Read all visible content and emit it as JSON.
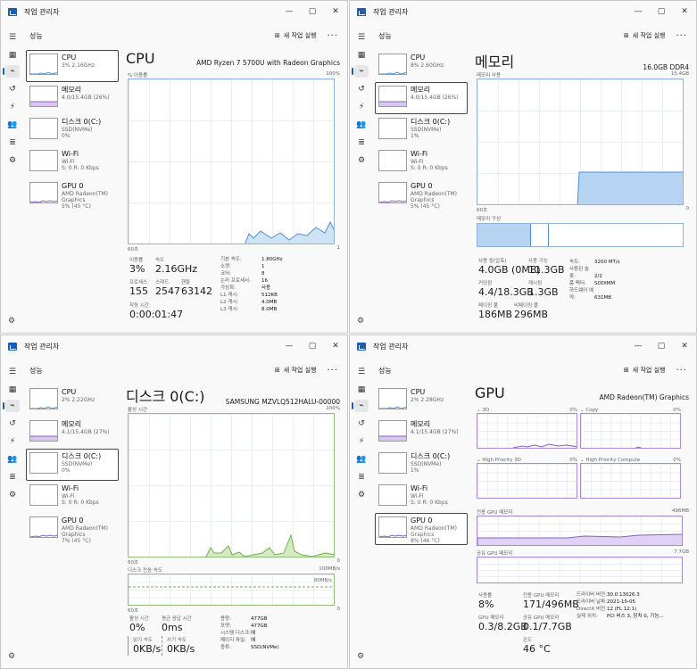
{
  "app_title": "작업 관리자",
  "page_title": "성능",
  "run_task": "새 작업 실행",
  "sidebar": [
    {
      "name": "CPU",
      "sub1": "3% 2.16GHz",
      "sub2": ""
    },
    {
      "name": "메모리",
      "sub1": "4.0/15.4GB (26%)",
      "sub2": ""
    },
    {
      "name": "디스크 0(C:)",
      "sub1": "SSD(NVMe)",
      "sub2": "0%"
    },
    {
      "name": "Wi-Fi",
      "sub1": "Wi-Fi",
      "sub2": "S: 0 R: 0 Kbps"
    },
    {
      "name": "GPU 0",
      "sub1": "AMD Radeon(TM) Graphics",
      "sub2": "5% (45 °C)"
    }
  ],
  "cpu": {
    "title": "CPU",
    "model": "AMD Ryzen 7 5700U with Radeon Graphics",
    "graph_label": "% 이용률",
    "graph_max": "100%",
    "graph_left": "60초",
    "graph_right": "1",
    "util_label": "이용률",
    "util": "3%",
    "speed_label": "속도",
    "speed": "2.16GHz",
    "proc_label": "프로세스",
    "proc": "155",
    "thread_label": "스레드",
    "thread": "2547",
    "handle_label": "핸들",
    "handle": "63142",
    "uptime_label": "작동 시간",
    "uptime": "0:00:01:47",
    "details": [
      [
        "기본 속도:",
        "1.80GHz"
      ],
      [
        "소켓:",
        "1"
      ],
      [
        "코어:",
        "8"
      ],
      [
        "논리 프로세서:",
        "16"
      ],
      [
        "가상화:",
        "사용"
      ],
      [
        "L1 캐시:",
        "512KB"
      ],
      [
        "L2 캐시:",
        "4.0MB"
      ],
      [
        "L3 캐시:",
        "8.0MB"
      ]
    ]
  },
  "mem_sidebar": [
    {
      "name": "CPU",
      "sub1": "8% 2.60GHz",
      "sub2": ""
    },
    {
      "name": "메모리",
      "sub1": "4.0/15.4GB (26%)",
      "sub2": ""
    },
    {
      "name": "디스크 0(C:)",
      "sub1": "SSD(NVMe)",
      "sub2": "1%"
    },
    {
      "name": "Wi-Fi",
      "sub1": "Wi-Fi",
      "sub2": "S: 0 R: 0 Kbps"
    },
    {
      "name": "GPU 0",
      "sub1": "AMD Radeon(TM) Graphics",
      "sub2": "5% (45 °C)"
    }
  ],
  "memory": {
    "title": "메모리",
    "size": "16.0GB DDR4",
    "graph_label": "메모리 사용",
    "graph_max": "15.4GB",
    "graph_left": "60초",
    "graph_right": "0",
    "comp_label": "메모리 구성",
    "used_label": "사용 중(압축)",
    "used": "4.0GB (0MB)",
    "avail_label": "사용 가능",
    "avail": "11.3GB",
    "commit_label": "커밋됨",
    "commit": "4.4/18.3GB",
    "cache_label": "캐시됨",
    "cache": "1.3GB",
    "paged_label": "페이징 풀",
    "paged": "186MB",
    "nonpaged_label": "비페이징 풀",
    "nonpaged": "296MB",
    "details": [
      [
        "속도:",
        "3200 MT/s"
      ],
      [
        "사용된 슬롯:",
        "2/2"
      ],
      [
        "폼 팩터:",
        "SODIMM"
      ],
      [
        "하드웨어 예약:",
        "631MB"
      ]
    ]
  },
  "disk_sidebar": [
    {
      "name": "CPU",
      "sub1": "2% 2.22GHz",
      "sub2": ""
    },
    {
      "name": "메모리",
      "sub1": "4.1/15.4GB (27%)",
      "sub2": ""
    },
    {
      "name": "디스크 0(C:)",
      "sub1": "SSD(NVMe)",
      "sub2": "0%"
    },
    {
      "name": "Wi-Fi",
      "sub1": "Wi-Fi",
      "sub2": "S: 0 R: 0 Kbps"
    },
    {
      "name": "GPU 0",
      "sub1": "AMD Radeon(TM) Graphics",
      "sub2": "7% (45 °C)"
    }
  ],
  "disk": {
    "title": "디스크 0(C:)",
    "model": "SAMSUNG MZVLQ512HALU-00000",
    "graph_label": "활성 시간",
    "graph_max": "100%",
    "graph_left": "60초",
    "graph_right": "0",
    "speed_label": "디스크 전송 속도",
    "speed_max": "100MB/s",
    "speed_mid": "80MB/s",
    "speed_left": "60초",
    "speed_right": "0",
    "active_label": "활성 시간",
    "active": "0%",
    "resp_label": "평균 응답 시간",
    "resp": "0ms",
    "read_label": "읽기 속도",
    "read": "0KB/s",
    "write_label": "쓰기 속도",
    "write": "0KB/s",
    "details": [
      [
        "용량:",
        "477GB"
      ],
      [
        "포맷:",
        "477GB"
      ],
      [
        "시스템 디스크:",
        "예"
      ],
      [
        "페이지 파일:",
        "예"
      ],
      [
        "종류:",
        "SSD(NVMe)"
      ]
    ]
  },
  "gpu_sidebar": [
    {
      "name": "CPU",
      "sub1": "2% 2.28GHz",
      "sub2": ""
    },
    {
      "name": "메모리",
      "sub1": "4.1/15.4GB (27%)",
      "sub2": ""
    },
    {
      "name": "디스크 0(C:)",
      "sub1": "SSD(NVMe)",
      "sub2": "1%"
    },
    {
      "name": "Wi-Fi",
      "sub1": "Wi-Fi",
      "sub2": "S: 0 R: 0 Kbps"
    },
    {
      "name": "GPU 0",
      "sub1": "AMD Radeon(TM) Graphics",
      "sub2": "8% (46 °C)"
    }
  ],
  "gpu": {
    "title": "GPU",
    "model": "AMD Radeon(TM) Graphics",
    "eng1": "3D",
    "eng1_pct": "0%",
    "eng2": "Copy",
    "eng2_pct": "0%",
    "eng3": "High Priority 3D",
    "eng3_pct": "0%",
    "eng4": "High Priority Compute",
    "eng4_pct": "0%",
    "shared_label": "전용 GPU 메모리",
    "shared_max": "496MB",
    "sysmem_label": "공유 GPU 메모리",
    "sysmem_max": "7.7GB",
    "util_label": "사용률",
    "util": "8%",
    "ded_label": "전용 GPU 메모리",
    "ded": "171/496MB",
    "gmem_label": "GPU 메모리",
    "gmem": "0.3/8.2GB",
    "shmem_label": "공유 GPU 메모리",
    "shmem": "0.1/7.7GB",
    "temp_label": "온도",
    "temp": "46 °C",
    "details": [
      [
        "드라이버 버전:",
        "30.0.13026.3"
      ],
      [
        "드라이버 날짜:",
        "2021-10-05"
      ],
      [
        "DirectX 버전:",
        "12 (FL 12.1)"
      ],
      [
        "실제 위치:",
        "PCI 버스 3, 장치 0, 기능..."
      ]
    ]
  }
}
